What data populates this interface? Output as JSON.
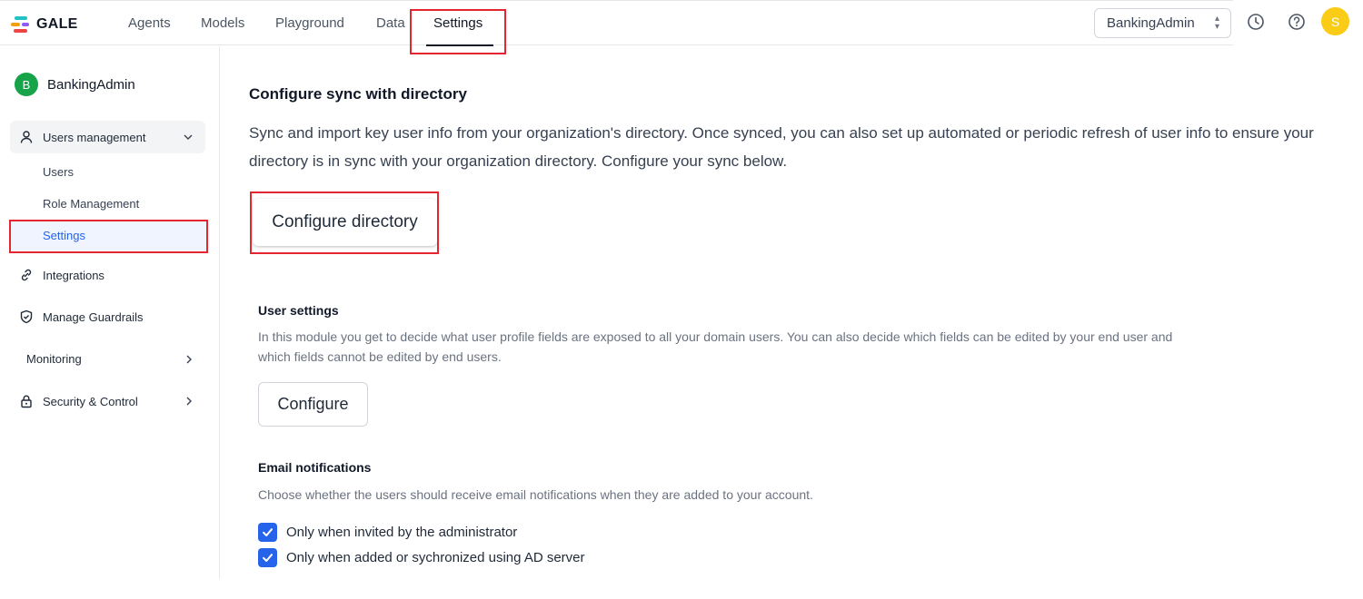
{
  "app": {
    "logo_text": "GALE"
  },
  "nav": {
    "tabs": [
      {
        "label": "Agents"
      },
      {
        "label": "Models"
      },
      {
        "label": "Playground"
      },
      {
        "label": "Data"
      },
      {
        "label": "Settings",
        "active": true
      }
    ],
    "workspace": "BankingAdmin",
    "user_initial": "S"
  },
  "sidebar": {
    "account_initial": "B",
    "account_name": "BankingAdmin",
    "users_management": {
      "label": "Users management",
      "children": [
        "Users",
        "Role Management",
        "Settings"
      ]
    },
    "integrations": "Integrations",
    "guardrails": "Manage Guardrails",
    "monitoring": "Monitoring",
    "security": "Security & Control"
  },
  "main": {
    "sync_title": "Configure sync with directory",
    "sync_description": "Sync and import key user info from your organization's directory. Once synced, you can also set up automated or periodic refresh of user info to ensure your directory is in sync with your organization directory. Configure your sync below.",
    "configure_directory_label": "Configure directory",
    "user_settings_title": "User settings",
    "user_settings_description": "In this module you get to decide what user profile fields are exposed to all your domain users. You can also decide which fields can be edited by your end user and which fields cannot be edited by end users.",
    "configure_label": "Configure",
    "email_title": "Email notifications",
    "email_description": "Choose whether the users should receive email notifications when they are added to your account.",
    "email_options": [
      {
        "label": "Only when invited by the administrator",
        "checked": true
      },
      {
        "label": "Only when added or sychronized using AD server",
        "checked": true
      }
    ]
  },
  "colors": {
    "accent": "#2563eb",
    "highlight": "#e3262f",
    "avatar_user": "#facc15",
    "avatar_account": "#16a34a"
  }
}
